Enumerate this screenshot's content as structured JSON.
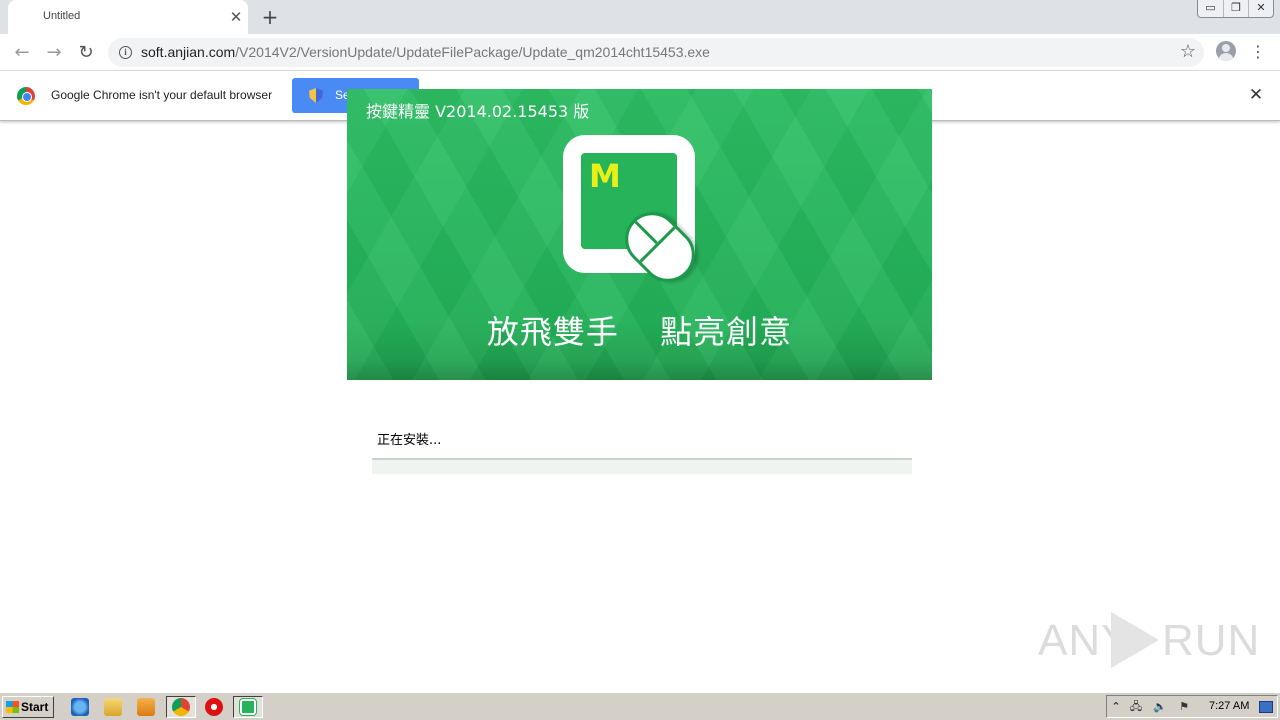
{
  "browser": {
    "tab_title": "Untitled",
    "url_host": "soft.anjian.com",
    "url_path": "/V2014V2/VersionUpdate/UpdateFilePackage/Update_qm2014cht15453.exe",
    "infobar_message": "Google Chrome isn't your default browser",
    "default_button_label": "Set as default"
  },
  "installer": {
    "title": "按鍵精靈 V2014.02.15453 版",
    "logo_letter": "M",
    "slogan": "放飛雙手 點亮創意",
    "status": "正在安裝...",
    "progress": 0,
    "accent_color": "#2dbf64"
  },
  "watermark": {
    "left": "ANY",
    "right": "RUN"
  },
  "taskbar": {
    "start_label": "Start",
    "clock": "7:27 AM"
  }
}
